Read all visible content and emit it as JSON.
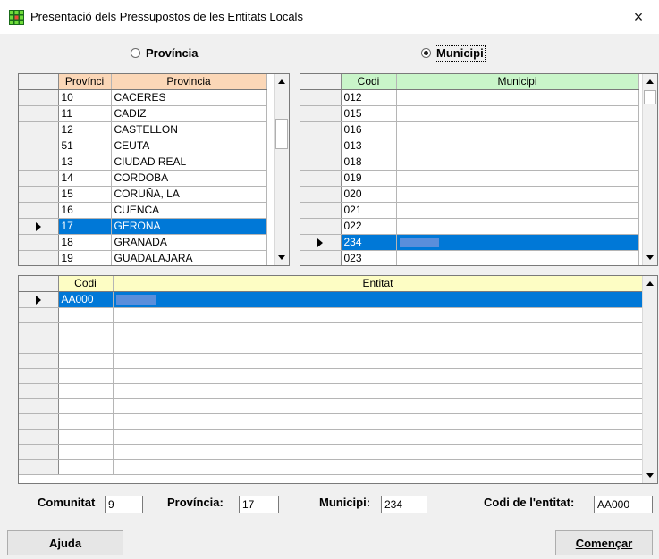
{
  "window": {
    "title": "Presentació dels Pressupostos de les Entitats Locals",
    "close": "×",
    "icon": "grid-app-icon"
  },
  "radios": {
    "provincia": {
      "label": "Província",
      "checked": false
    },
    "municipi": {
      "label": "Municipi",
      "checked": true
    }
  },
  "provincia_grid": {
    "columns": [
      "Provínci",
      "Provincia"
    ],
    "header_color": "#fbd7b7",
    "rows": [
      {
        "code": "10",
        "name": "CACERES"
      },
      {
        "code": "11",
        "name": "CADIZ"
      },
      {
        "code": "12",
        "name": "CASTELLON"
      },
      {
        "code": "51",
        "name": "CEUTA"
      },
      {
        "code": "13",
        "name": "CIUDAD REAL"
      },
      {
        "code": "14",
        "name": "CORDOBA"
      },
      {
        "code": "15",
        "name": "CORUÑA, LA"
      },
      {
        "code": "16",
        "name": "CUENCA"
      },
      {
        "code": "17",
        "name": "GERONA",
        "selected": true
      },
      {
        "code": "18",
        "name": "GRANADA"
      },
      {
        "code": "19",
        "name": "GUADALAJARA"
      }
    ]
  },
  "municipi_grid": {
    "columns": [
      "Codi",
      "Municipi"
    ],
    "header_color": "#c9f5c9",
    "rows": [
      {
        "code": "012"
      },
      {
        "code": "015"
      },
      {
        "code": "016"
      },
      {
        "code": "013"
      },
      {
        "code": "018"
      },
      {
        "code": "019"
      },
      {
        "code": "020"
      },
      {
        "code": "021"
      },
      {
        "code": "022"
      },
      {
        "code": "234",
        "selected": true
      },
      {
        "code": "023"
      }
    ]
  },
  "entitat_grid": {
    "columns": [
      "Codi",
      "Entitat"
    ],
    "header_color": "#fdfdc4",
    "rows": [
      {
        "code": "AA000",
        "selected": true
      }
    ]
  },
  "form": {
    "comunitat_label": "Comunitat",
    "comunitat_value": "9",
    "provincia_label": "Província:",
    "provincia_value": "17",
    "municipi_label": "Municipi:",
    "municipi_value": "234",
    "codi_entitat_label": "Codi de l'entitat:",
    "codi_entitat_value": "AA000"
  },
  "buttons": {
    "ajuda": "Ajuda",
    "comencar": "Començar"
  },
  "colors": {
    "selection": "#0078d7",
    "selection_bar": "#5a8edb"
  }
}
